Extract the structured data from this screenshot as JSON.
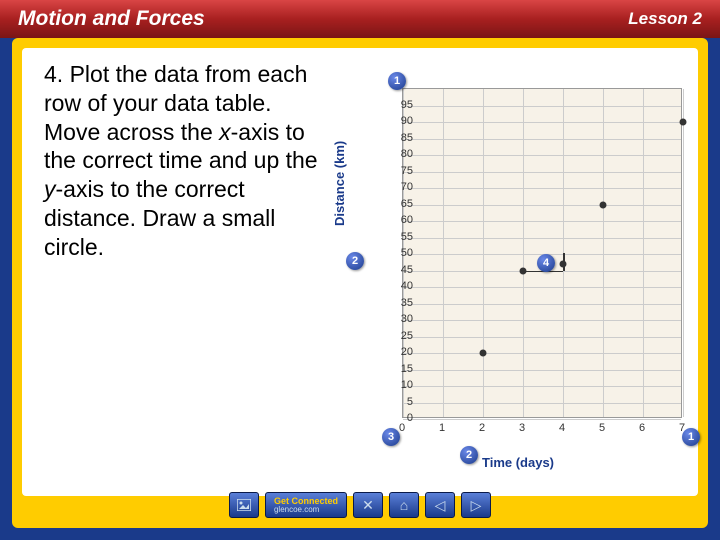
{
  "header": {
    "title": "Motion and Forces",
    "lesson": "Lesson 2"
  },
  "instruction": {
    "number": "4.",
    "text_before_x": "Plot the data from each row of your data table. Move across the ",
    "x_italic": "x",
    "text_mid": "-axis to the correct time and up the ",
    "y_italic": "y",
    "text_after_y": "-axis to the correct distance. Draw a small circle."
  },
  "chart_data": {
    "type": "scatter",
    "xlabel": "Time (days)",
    "ylabel": "Distance (km)",
    "xlim": [
      0,
      7
    ],
    "ylim": [
      0,
      100
    ],
    "xticks": [
      0,
      1,
      2,
      3,
      4,
      5,
      6,
      7
    ],
    "yticks": [
      0,
      5,
      10,
      15,
      20,
      25,
      30,
      35,
      40,
      45,
      50,
      55,
      60,
      65,
      70,
      75,
      80,
      85,
      90,
      95
    ],
    "points": [
      {
        "x": 2,
        "y": 20
      },
      {
        "x": 3,
        "y": 45
      },
      {
        "x": 4,
        "y": 47
      },
      {
        "x": 5,
        "y": 65
      },
      {
        "x": 7,
        "y": 90
      }
    ],
    "markers": [
      {
        "id": "1",
        "pos": "top-left"
      },
      {
        "id": "2",
        "pos": "y-label"
      },
      {
        "id": "3",
        "pos": "origin"
      },
      {
        "id": "2",
        "pos": "x-label"
      },
      {
        "id": "1",
        "pos": "x-end"
      },
      {
        "id": "4",
        "pos": "data-point"
      }
    ]
  },
  "footer": {
    "connect_title": "Get Connected",
    "connect_url": "glencoe.com"
  }
}
